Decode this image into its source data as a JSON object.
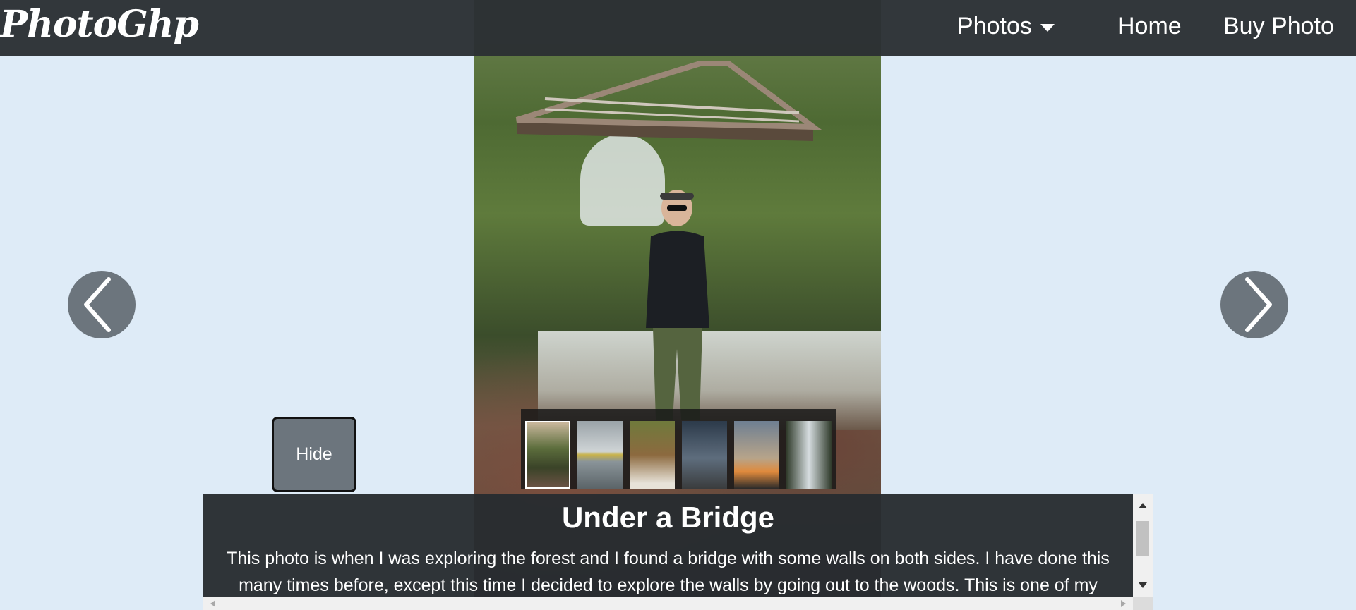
{
  "navbar": {
    "brand": "PhotoGhp",
    "items": [
      {
        "label": "Photos",
        "dropdown": true
      },
      {
        "label": "Home"
      },
      {
        "label": "Buy Photo"
      }
    ],
    "background": "#2b2f33"
  },
  "page": {
    "background": "#deebf7"
  },
  "carousel": {
    "prev_icon": "chevron-left-icon",
    "next_icon": "chevron-right-icon",
    "arrow_color": "#6c757d"
  },
  "hide_button": {
    "label": "Hide"
  },
  "thumbnails": [
    {
      "subject": "bridge",
      "active": true
    },
    {
      "subject": "water-reflection"
    },
    {
      "subject": "forest-frame"
    },
    {
      "subject": "group-on-rocks"
    },
    {
      "subject": "sunset-silhouette"
    },
    {
      "subject": "waterfall"
    }
  ],
  "caption": {
    "title": "Under a Bridge",
    "text": "This photo is when I was exploring the forest and I found a bridge with some walls on both sides. I have done this many times before, except this time I decided to explore the walls by going out to the woods. This is one of my"
  }
}
